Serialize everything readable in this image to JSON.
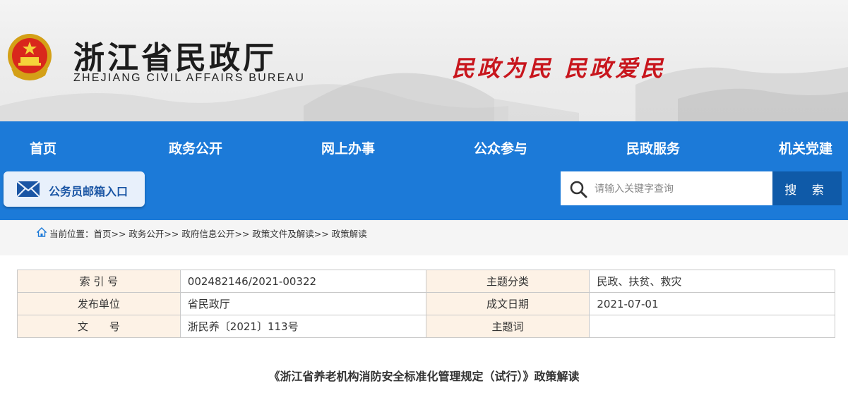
{
  "header": {
    "title_cn": "浙江省民政厅",
    "title_en": "ZHEJIANG CIVIL AFFAIRS BUREAU",
    "slogan": "民政为民  民政爱民",
    "emblem_icon": "national-emblem-icon"
  },
  "nav": {
    "items": [
      "首页",
      "政务公开",
      "网上办事",
      "公众参与",
      "民政服务",
      "机关党建"
    ]
  },
  "mailbox": {
    "label": "公务员邮箱入口",
    "icon": "envelope-icon"
  },
  "search": {
    "placeholder": "请输入关键字查询",
    "button_label": "搜 索",
    "icon": "search-icon"
  },
  "breadcrumb": {
    "text": "当前位置：首页>> 政务公开>> 政府信息公开>> 政策文件及解读>> 政策解读",
    "icon": "home-icon"
  },
  "meta": {
    "rows": [
      {
        "k1": "索 引 号",
        "v1": "002482146/2021-00322",
        "k2": "主题分类",
        "v2": "民政、扶贫、救灾"
      },
      {
        "k1": "发布单位",
        "v1": "省民政厅",
        "k2": "成文日期",
        "v2": "2021-07-01"
      },
      {
        "k1": "文　　号",
        "v1": "浙民养〔2021〕113号",
        "k2": "主题词",
        "v2": ""
      }
    ]
  },
  "document": {
    "title": "《浙江省养老机构消防安全标准化管理规定（试行）》政策解读"
  },
  "colors": {
    "nav_blue": "#1c7ad8",
    "search_button": "#0f5aa8",
    "slogan_red": "#c8161d",
    "key_cell_bg": "#fdf2e6"
  }
}
